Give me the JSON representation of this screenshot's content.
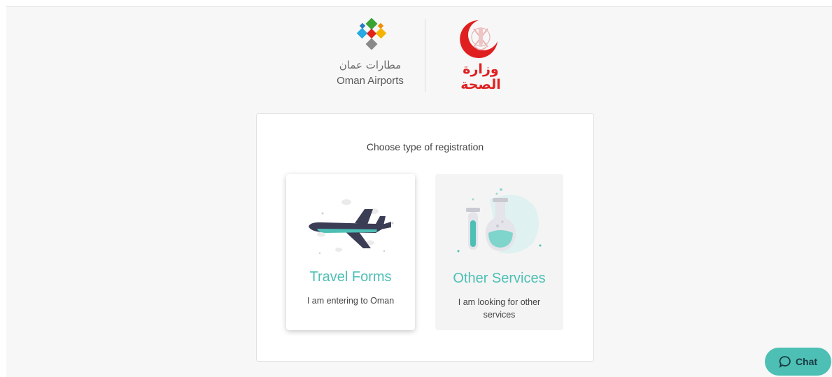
{
  "header": {
    "oman_airports": {
      "arabic_name": "مطارات عمان",
      "english_name": "Oman Airports",
      "icon": "oman-airports-logo-icon"
    },
    "ministry_of_health": {
      "arabic_name": "وزارة الصحة",
      "icon": "oman-emblem-icon"
    }
  },
  "registration": {
    "title": "Choose type of registration",
    "options": [
      {
        "heading": "Travel Forms",
        "description": "I am entering to Oman",
        "icon": "airplane-icon"
      },
      {
        "heading": "Other Services",
        "description": "I am looking for other services",
        "icon": "lab-flask-icon"
      }
    ]
  },
  "chat": {
    "label": "Chat",
    "icon": "chat-bubble-icon"
  },
  "colors": {
    "accent": "#4dbfb4",
    "ministry_red": "#e02020",
    "plane_body": "#3b3d55",
    "page_background": "#f7f7f7"
  }
}
